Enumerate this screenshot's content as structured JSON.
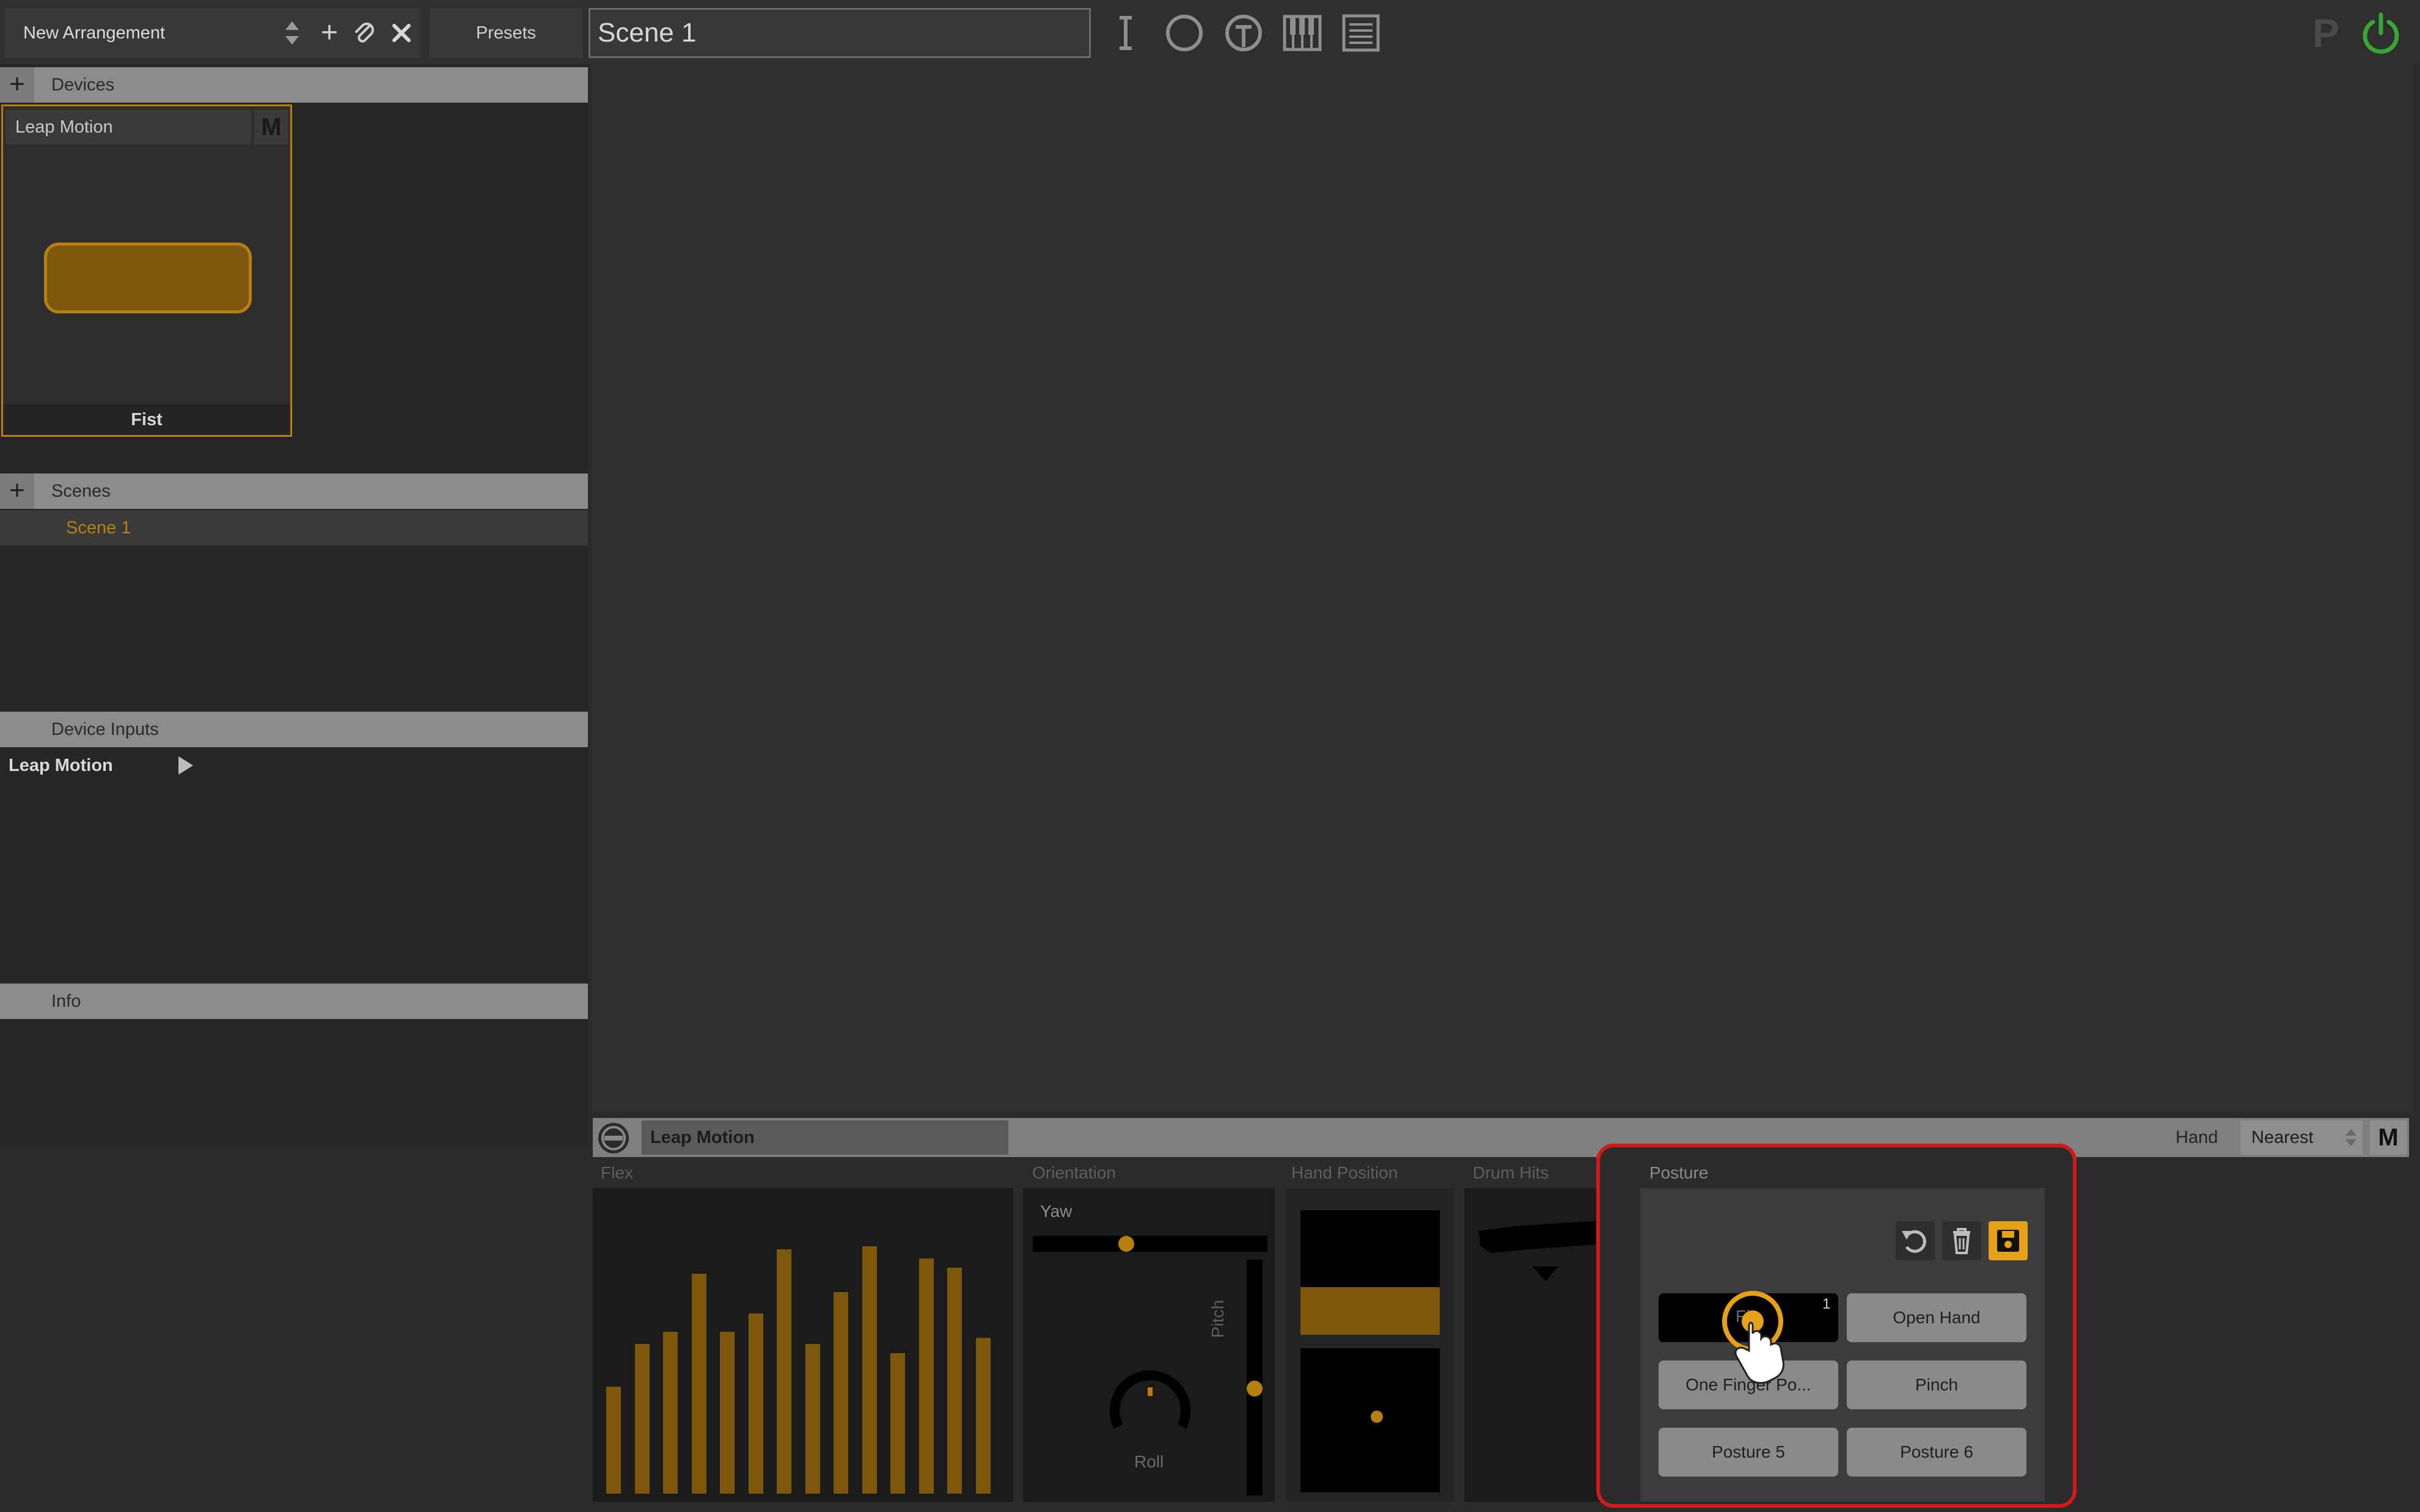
{
  "toolbar": {
    "arrangement": "New Arrangement",
    "presets": "Presets",
    "scene_name": "Scene 1",
    "p_label": "P",
    "colors": {
      "accent": "#b7800e",
      "power": "#38a635",
      "bg": "#2b2b2b"
    }
  },
  "devices": {
    "header": "Devices",
    "card": {
      "title": "Leap Motion",
      "m_label": "M",
      "posture": "Fist"
    }
  },
  "scenes": {
    "header": "Scenes",
    "items": [
      "Scene 1"
    ]
  },
  "device_inputs": {
    "header": "Device Inputs",
    "items": [
      "Leap Motion"
    ]
  },
  "info": {
    "header": "Info"
  },
  "device_panel": {
    "name": "Leap Motion",
    "hand_label": "Hand",
    "hand_value": "Nearest",
    "m_label": "M",
    "flex": {
      "title": "Flex",
      "levels": [
        0.35,
        0.49,
        0.53,
        0.72,
        0.53,
        0.59,
        0.8,
        0.49,
        0.66,
        0.81,
        0.46,
        0.77,
        0.74,
        0.51
      ]
    },
    "orientation": {
      "title": "Orientation",
      "yaw_label": "Yaw",
      "pitch_label": "Pitch",
      "roll_label": "Roll",
      "yaw": 0.39,
      "pitch": 0.55
    },
    "hand_position": {
      "title": "Hand Position"
    },
    "drum_hits": {
      "title": "Drum Hits"
    },
    "posture": {
      "title": "Posture",
      "buttons": [
        {
          "label": "Fi",
          "badge": "1",
          "selected": true
        },
        {
          "label": "Open Hand"
        },
        {
          "label": "One Finger Po..."
        },
        {
          "label": "Pinch"
        },
        {
          "label": "Posture 5"
        },
        {
          "label": "Posture 6"
        }
      ]
    }
  }
}
